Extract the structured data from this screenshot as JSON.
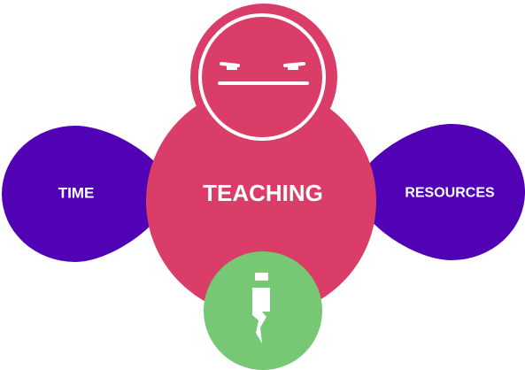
{
  "diagram": {
    "center": {
      "label": "TEACHING",
      "color": "#da3d67"
    },
    "left": {
      "label": "TIME",
      "color": "#5102b5"
    },
    "right": {
      "label": "RESOURCES",
      "color": "#5102b5"
    },
    "bottom_icon": {
      "icon": "pen-nib-icon",
      "color": "#76c874"
    },
    "face_icon": {
      "icon": "unamused-face-icon"
    }
  }
}
